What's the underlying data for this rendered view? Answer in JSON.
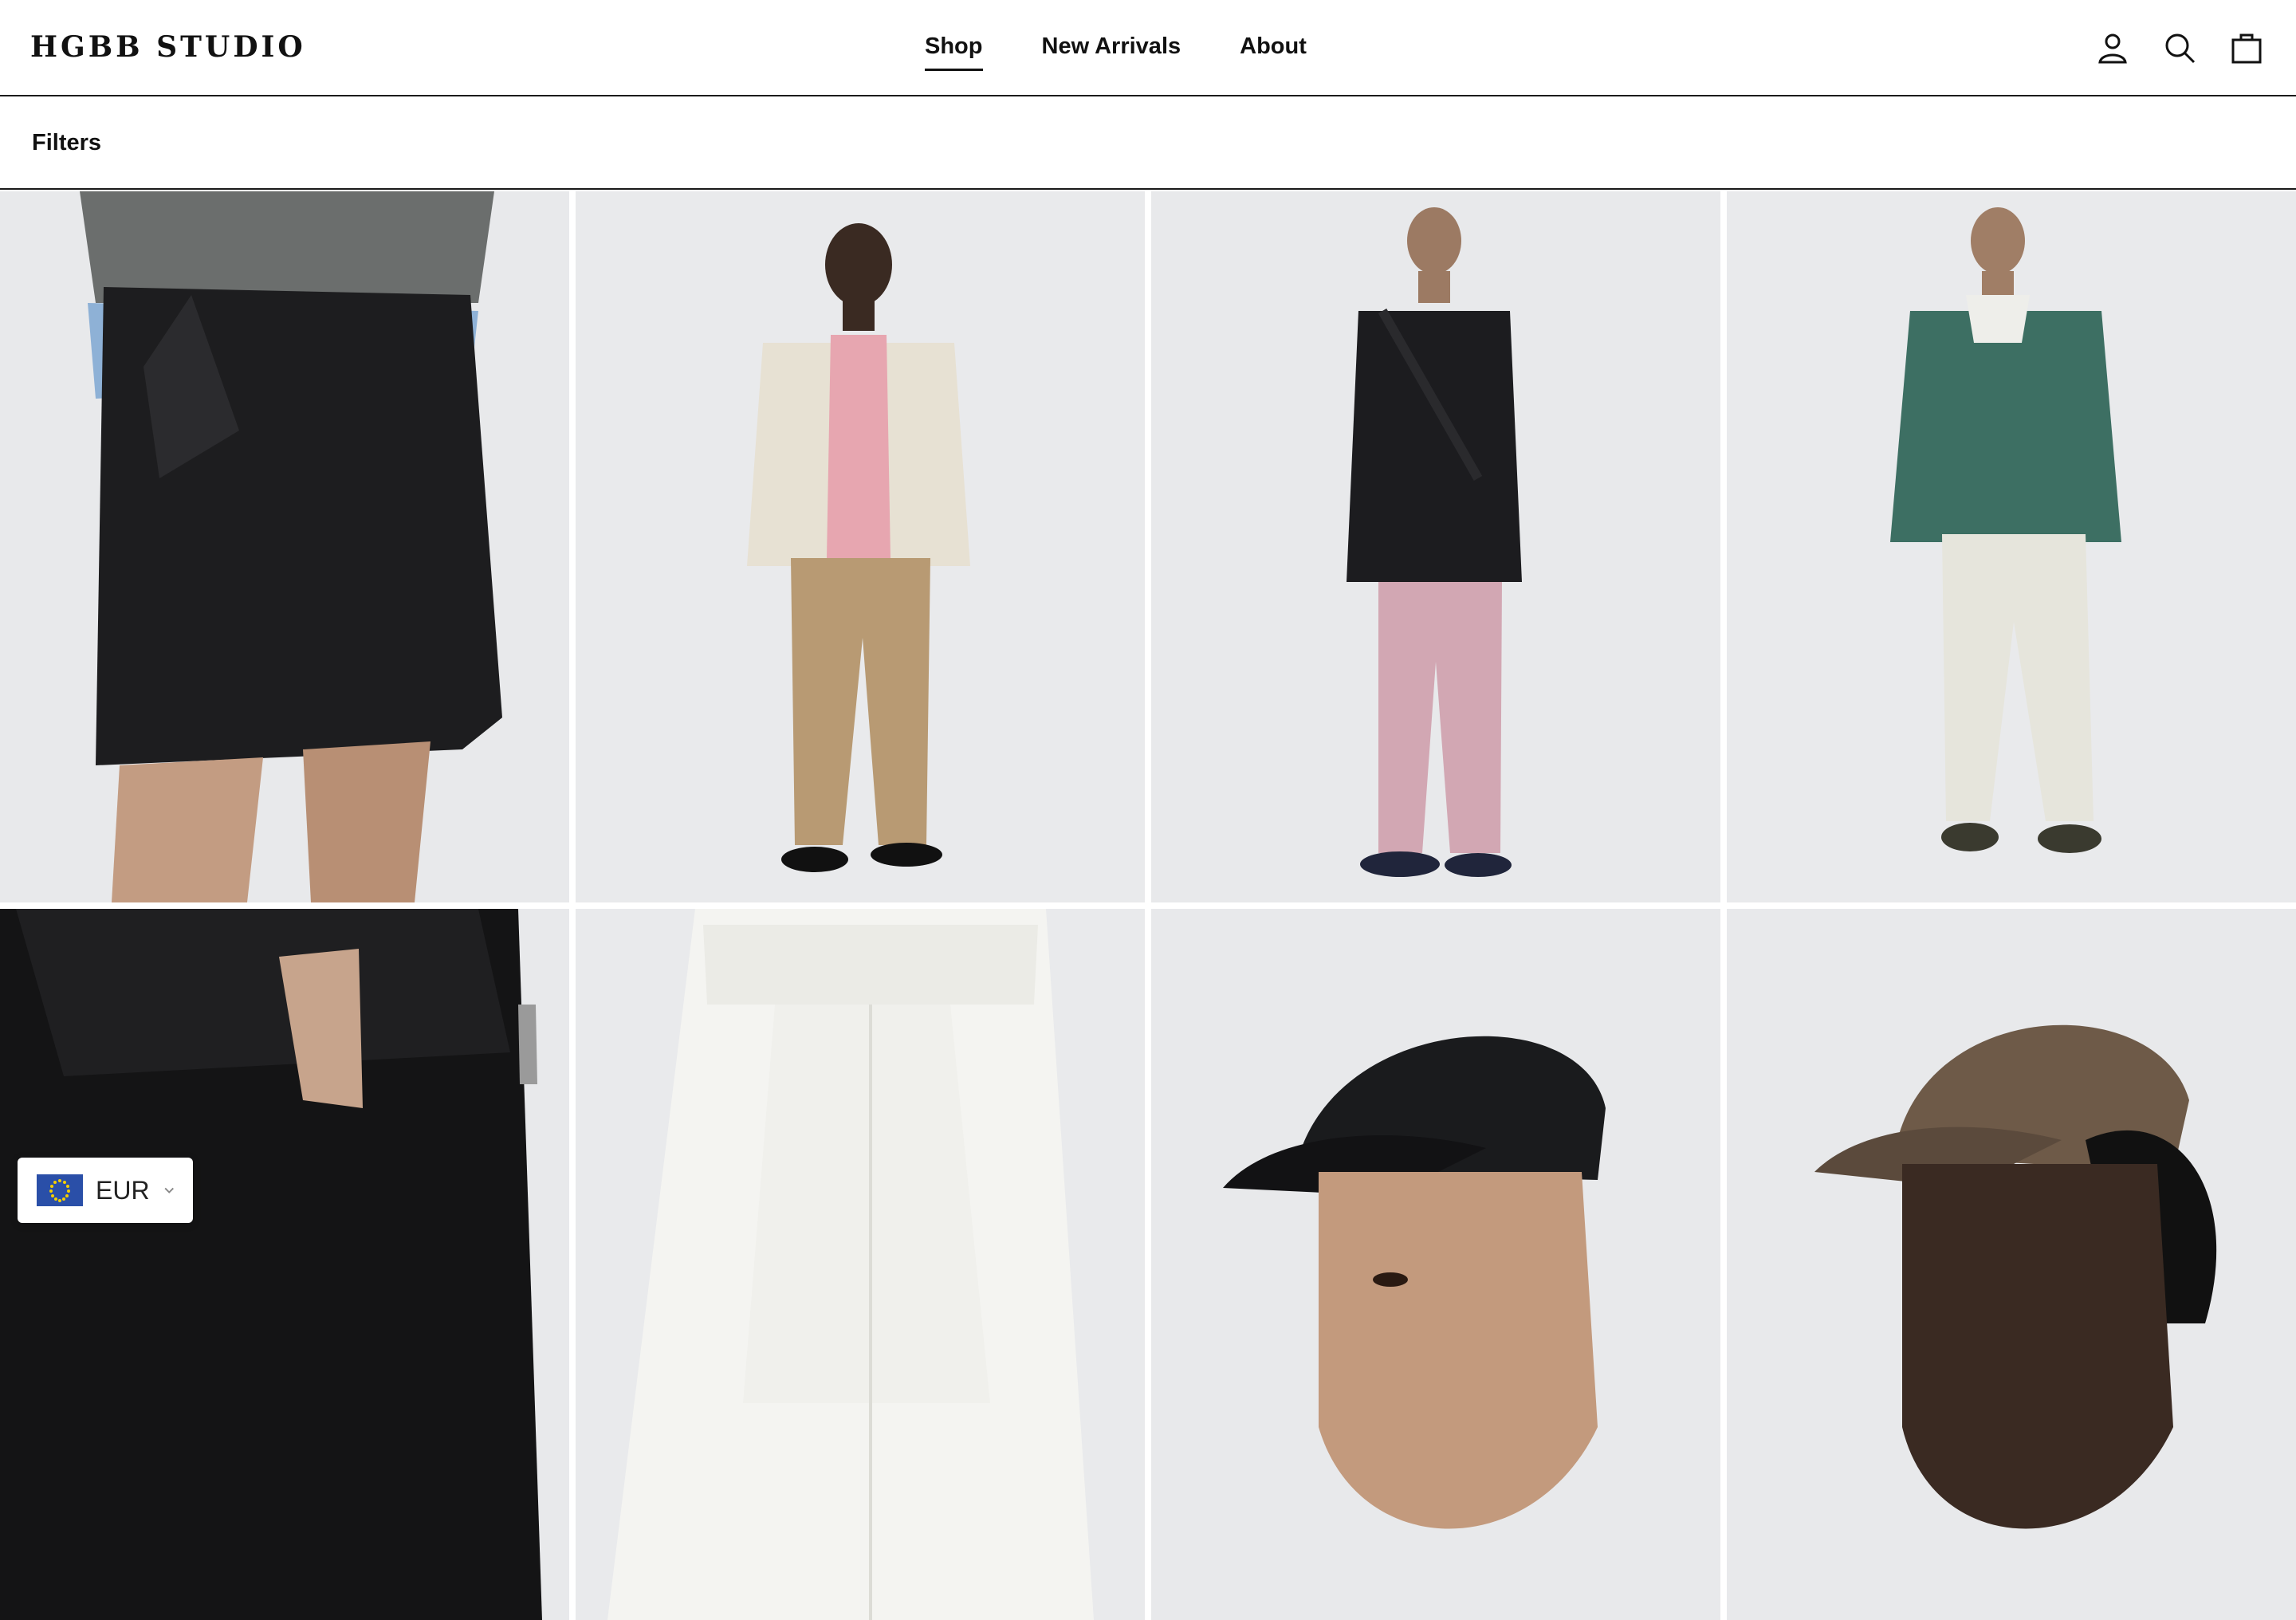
{
  "brand": {
    "logo_text": "HGBB STUDIO"
  },
  "nav": {
    "items": [
      {
        "label": "Shop",
        "active": true
      },
      {
        "label": "New Arrivals",
        "active": false
      },
      {
        "label": "About",
        "active": false
      }
    ]
  },
  "header_icons": [
    "account-icon",
    "search-icon",
    "cart-icon"
  ],
  "filters": {
    "label": "Filters"
  },
  "products": [
    {
      "image_subject": "black nylon shorts with drawstring, close-up"
    },
    {
      "image_subject": "model in cream jacket, pink shirt, khaki trousers"
    },
    {
      "image_subject": "model in black overshirt, pink trousers, crossbody bag"
    },
    {
      "image_subject": "model in green track jacket, off-white trousers"
    },
    {
      "image_subject": "black trousers with zip pocket, close-up"
    },
    {
      "image_subject": "white drawstring trousers, close-up"
    },
    {
      "image_subject": "model wearing black nylon cap"
    },
    {
      "image_subject": "model wearing brown cap"
    }
  ],
  "currency": {
    "code": "EUR",
    "flag": "eu-flag-icon"
  },
  "colors": {
    "text": "#111111",
    "border": "#1a1a1a",
    "photo_background": "#e9eaec",
    "eu_blue": "#2a4fa8",
    "eu_star": "#f5d000"
  }
}
